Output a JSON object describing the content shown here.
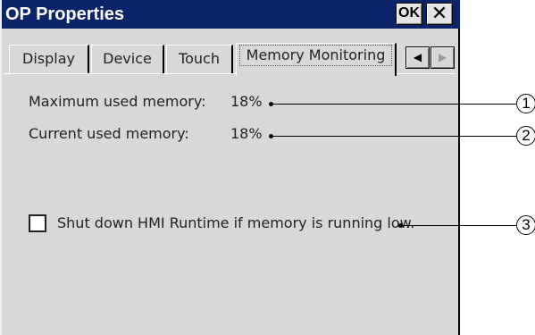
{
  "window": {
    "title": "OP Properties",
    "ok_label": "OK",
    "close_label": "✕"
  },
  "tabs": [
    {
      "label": "Display"
    },
    {
      "label": "Device"
    },
    {
      "label": "Touch"
    },
    {
      "label": "Memory Monitoring",
      "active": true
    }
  ],
  "tab_scroll": {
    "left_icon": "◀",
    "right_icon": "▶"
  },
  "memory": {
    "max_label": "Maximum used memory:",
    "max_value": "18%",
    "current_label": "Current used memory:",
    "current_value": "18%",
    "shutdown_label": "Shut down HMI Runtime if memory is running low.",
    "shutdown_checked": false
  },
  "callouts": [
    "1",
    "2",
    "3"
  ],
  "colors": {
    "titlebar": "#0a246a",
    "window_bg": "#d8d8d8"
  }
}
